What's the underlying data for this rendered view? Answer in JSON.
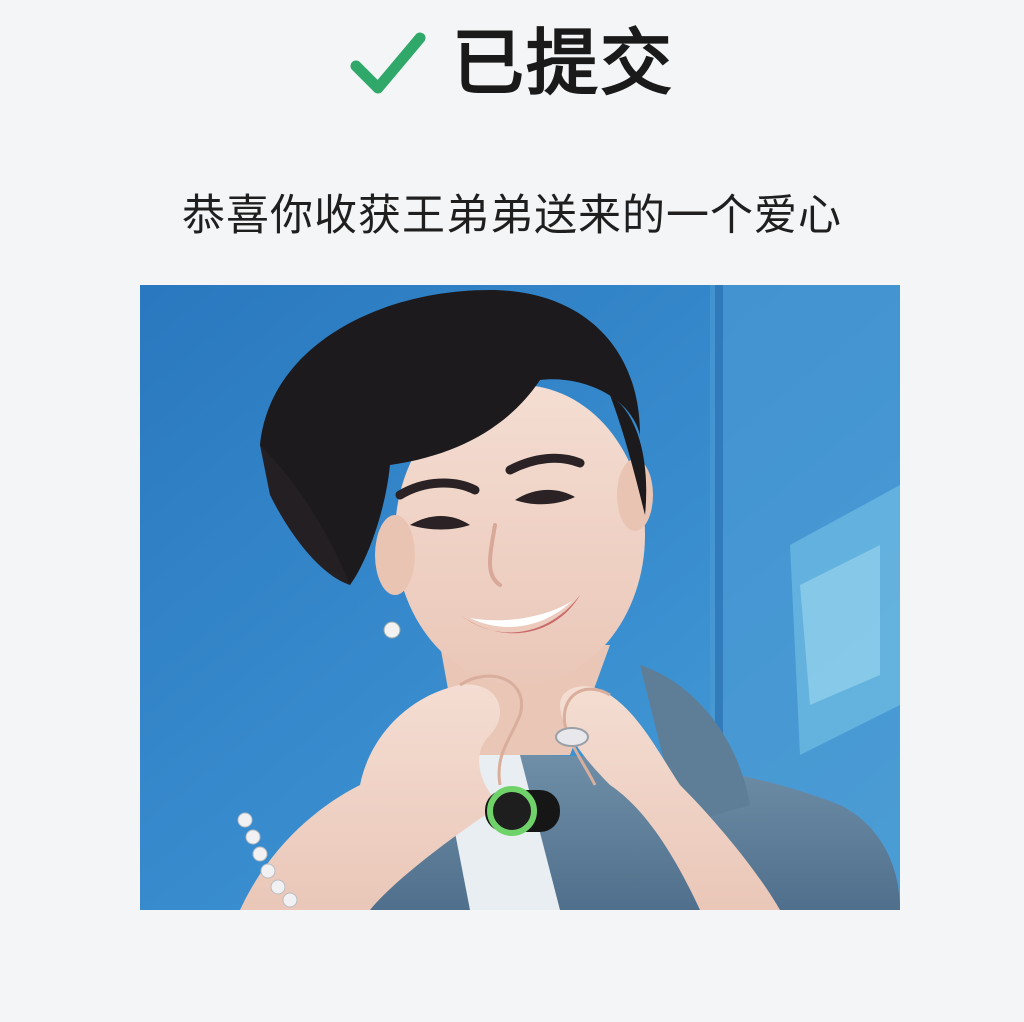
{
  "status": {
    "icon": "checkmark-icon",
    "icon_color": "#2fa86a",
    "label": "已提交"
  },
  "message": {
    "text": "恭喜你收获王弟弟送来的一个爱心"
  },
  "photo": {
    "icon": "photo-heart-gesture",
    "background_color": "#2f7fc2"
  }
}
